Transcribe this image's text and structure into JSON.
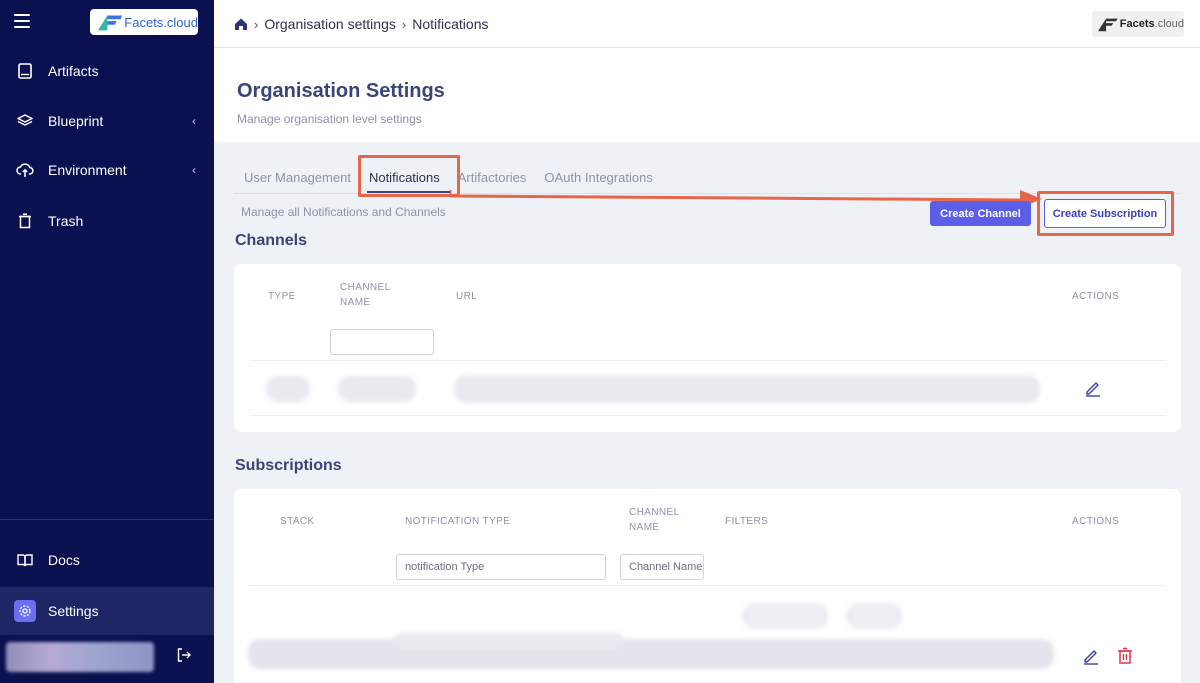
{
  "sidebar": {
    "logo_text": "Facets.cloud",
    "items": [
      {
        "label": "Artifacts",
        "icon": "tablet-icon"
      },
      {
        "label": "Blueprint",
        "icon": "layers-icon"
      },
      {
        "label": "Environment",
        "icon": "cloud-upload-icon"
      },
      {
        "label": "Trash",
        "icon": "trash-icon"
      }
    ],
    "bottom": [
      {
        "label": "Docs",
        "icon": "book-icon"
      },
      {
        "label": "Settings",
        "icon": "gear-icon"
      }
    ]
  },
  "header": {
    "breadcrumb": [
      "Organisation settings",
      "Notifications"
    ],
    "logo_text": "Facets",
    "logo_suffix": ".cloud"
  },
  "page": {
    "title": "Organisation Settings",
    "subtitle": "Manage organisation level settings"
  },
  "tabs": [
    {
      "label": "User Management"
    },
    {
      "label": "Notifications"
    },
    {
      "label": "Artifactories"
    },
    {
      "label": "OAuth Integrations"
    }
  ],
  "notifications": {
    "description": "Manage all Notifications and Channels",
    "create_channel_label": "Create Channel",
    "create_subscription_label": "Create Subscription"
  },
  "channels": {
    "title": "Channels",
    "columns": {
      "type": "TYPE",
      "channel_name_1": "CHANNEL",
      "channel_name_2": "NAME",
      "url": "URL",
      "actions": "ACTIONS"
    }
  },
  "subscriptions": {
    "title": "Subscriptions",
    "columns": {
      "stack": "STACK",
      "notification_type": "NOTIFICATION TYPE",
      "channel_name_1": "CHANNEL",
      "channel_name_2": "NAME",
      "filters": "FILTERS",
      "actions": "ACTIONS"
    },
    "filter_notification_type": "notification Type",
    "filter_channel_name": "Channel Name"
  },
  "colors": {
    "sidebar": "#0b1150",
    "accent": "#5b5ee6",
    "highlight": "#e5664a",
    "title": "#3a4577"
  }
}
